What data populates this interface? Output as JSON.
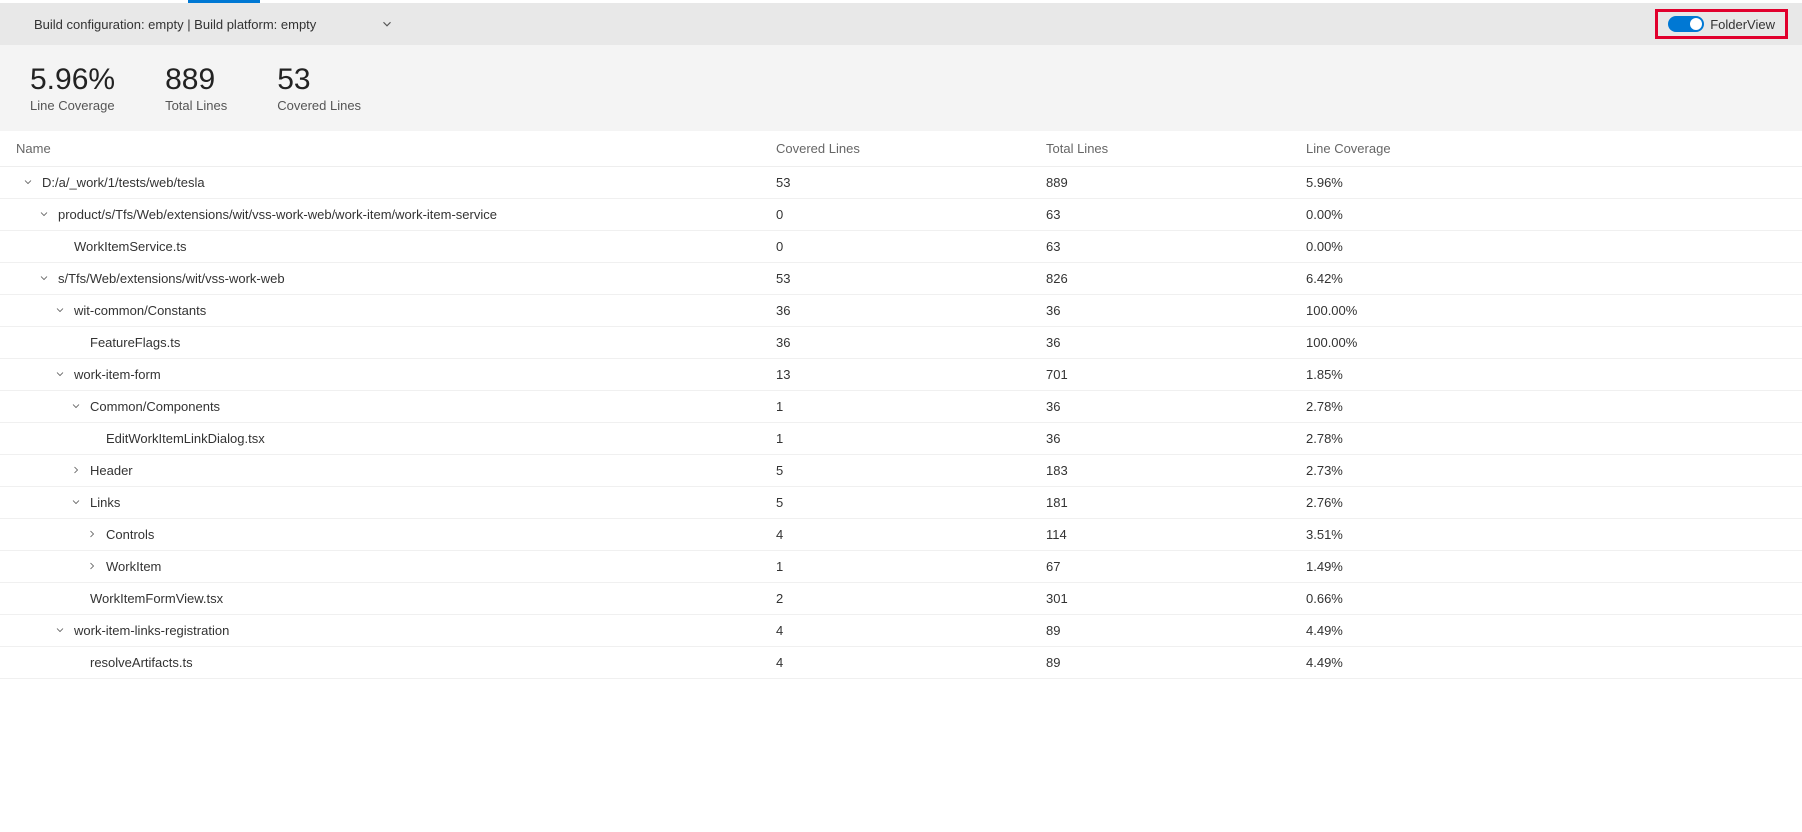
{
  "configBar": {
    "text": "Build configuration: empty | Build platform: empty",
    "folderViewLabel": "FolderView"
  },
  "metrics": {
    "lineCoverage": {
      "value": "5.96%",
      "label": "Line Coverage"
    },
    "totalLines": {
      "value": "889",
      "label": "Total Lines"
    },
    "coveredLines": {
      "value": "53",
      "label": "Covered Lines"
    }
  },
  "columns": {
    "name": "Name",
    "covered": "Covered Lines",
    "total": "Total Lines",
    "coverage": "Line Coverage"
  },
  "rows": [
    {
      "indent": 0,
      "icon": "down",
      "name": "D:/a/_work/1/tests/web/tesla",
      "covered": "53",
      "total": "889",
      "coverage": "5.96%"
    },
    {
      "indent": 1,
      "icon": "down",
      "name": "product/s/Tfs/Web/extensions/wit/vss-work-web/work-item/work-item-service",
      "covered": "0",
      "total": "63",
      "coverage": "0.00%"
    },
    {
      "indent": 2,
      "icon": "none",
      "name": "WorkItemService.ts",
      "covered": "0",
      "total": "63",
      "coverage": "0.00%"
    },
    {
      "indent": 1,
      "icon": "down",
      "name": "s/Tfs/Web/extensions/wit/vss-work-web",
      "covered": "53",
      "total": "826",
      "coverage": "6.42%"
    },
    {
      "indent": 2,
      "icon": "down",
      "name": "wit-common/Constants",
      "covered": "36",
      "total": "36",
      "coverage": "100.00%"
    },
    {
      "indent": 3,
      "icon": "none",
      "name": "FeatureFlags.ts",
      "covered": "36",
      "total": "36",
      "coverage": "100.00%"
    },
    {
      "indent": 2,
      "icon": "down",
      "name": "work-item-form",
      "covered": "13",
      "total": "701",
      "coverage": "1.85%"
    },
    {
      "indent": 3,
      "icon": "down",
      "name": "Common/Components",
      "covered": "1",
      "total": "36",
      "coverage": "2.78%"
    },
    {
      "indent": 4,
      "icon": "none",
      "name": "EditWorkItemLinkDialog.tsx",
      "covered": "1",
      "total": "36",
      "coverage": "2.78%"
    },
    {
      "indent": 3,
      "icon": "right",
      "name": "Header",
      "covered": "5",
      "total": "183",
      "coverage": "2.73%"
    },
    {
      "indent": 3,
      "icon": "down",
      "name": "Links",
      "covered": "5",
      "total": "181",
      "coverage": "2.76%"
    },
    {
      "indent": 4,
      "icon": "right",
      "name": "Controls",
      "covered": "4",
      "total": "114",
      "coverage": "3.51%"
    },
    {
      "indent": 4,
      "icon": "right",
      "name": "WorkItem",
      "covered": "1",
      "total": "67",
      "coverage": "1.49%"
    },
    {
      "indent": 3,
      "icon": "none",
      "name": "WorkItemFormView.tsx",
      "covered": "2",
      "total": "301",
      "coverage": "0.66%"
    },
    {
      "indent": 2,
      "icon": "down",
      "name": "work-item-links-registration",
      "covered": "4",
      "total": "89",
      "coverage": "4.49%"
    },
    {
      "indent": 3,
      "icon": "none",
      "name": "resolveArtifacts.ts",
      "covered": "4",
      "total": "89",
      "coverage": "4.49%"
    }
  ]
}
